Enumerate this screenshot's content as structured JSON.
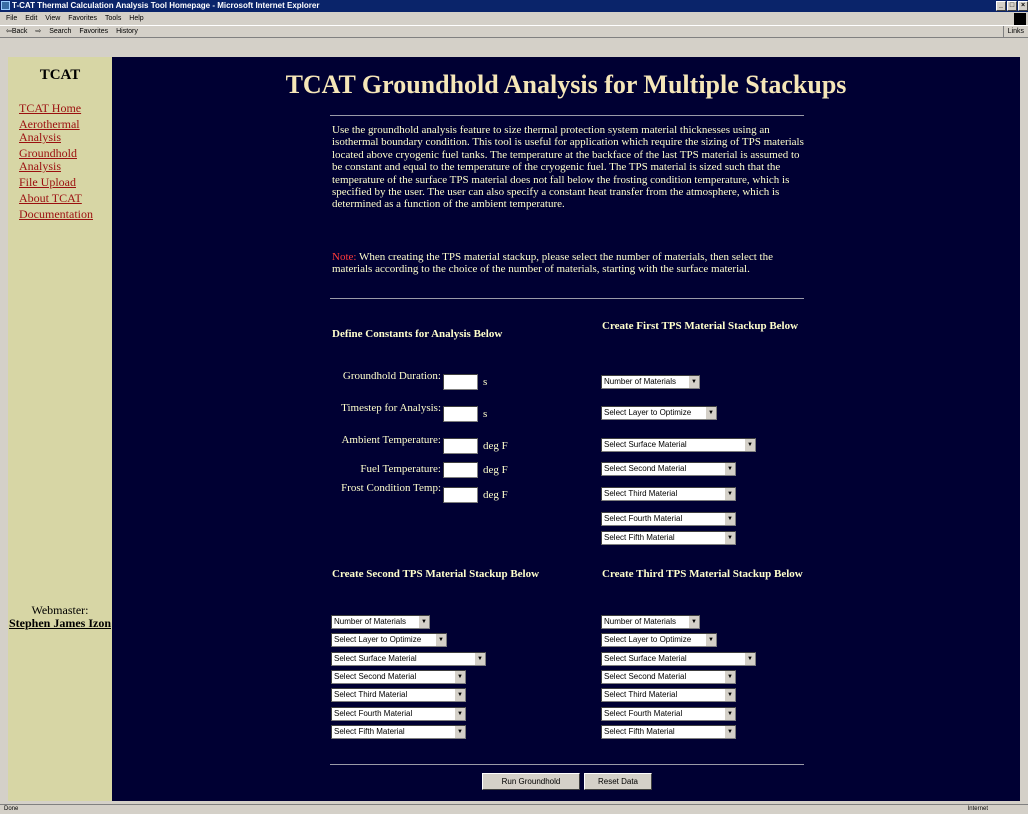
{
  "window": {
    "title": "T-CAT Thermal Calculation Analysis Tool Homepage - Microsoft Internet Explorer",
    "menu": [
      "File",
      "Edit",
      "View",
      "Favorites",
      "Tools",
      "Help"
    ],
    "toolbar": [
      "⇦Back",
      "⇨",
      "Search",
      "Favorites",
      "History"
    ],
    "links": "Links",
    "status_left": "Done",
    "status_right": "Internet"
  },
  "sidebar": {
    "brand": "TCAT",
    "items": [
      {
        "label": "TCAT Home"
      },
      {
        "label": "Aerothermal Analysis"
      },
      {
        "label": "Groundhold Analysis"
      },
      {
        "label": "File Upload"
      },
      {
        "label": "About TCAT"
      },
      {
        "label": "Documentation"
      }
    ],
    "webmaster_label": "Webmaster:",
    "webmaster_name": "Stephen James Izon"
  },
  "main": {
    "title": "TCAT Groundhold Analysis for Multiple Stackups",
    "intro": "Use the groundhold analysis feature to size thermal protection system material thicknesses using an isothermal boundary condition. This tool is useful for application which require the sizing of TPS materials located above cryogenic fuel tanks. The temperature at the backface of the last TPS material is assumed to be constant and equal to the temperature of the cryogenic fuel. The TPS material is sized such that the temperature of the surface TPS material does not fall below the frosting condition temperature, which is specified by the user. The user can also specify a constant heat transfer from the atmosphere, which is determined as a function of the ambient temperature.",
    "note_label": "Note:",
    "note_text": " When creating the TPS material stackup, please select the number of materials, then select the materials according to the choice of the number of materials, starting with the surface material.",
    "constants_heading": "Define Constants for Analysis Below",
    "constants": [
      {
        "label": "Groundhold Duration:",
        "unit": "s"
      },
      {
        "label": "Timestep for Analysis:",
        "unit": "s"
      },
      {
        "label": "Ambient Temperature:",
        "unit": "deg F"
      },
      {
        "label": "Fuel Temperature:",
        "unit": "deg F"
      },
      {
        "label": "Frost Condition Temp:",
        "unit": "deg F"
      }
    ],
    "stack1_heading": "Create First TPS Material Stackup Below",
    "stack2_heading": "Create Second TPS Material Stackup Below",
    "stack3_heading": "Create Third TPS Material Stackup Below",
    "selects": {
      "num": "Number of Materials",
      "layer": "Select Layer to Optimize",
      "surface": "Select Surface Material",
      "second": "Select Second Material",
      "third": "Select Third Material",
      "fourth": "Select Fourth Material",
      "fifth": "Select Fifth Material"
    },
    "run_button": "Run Groundhold",
    "reset_button": "Reset Data"
  }
}
